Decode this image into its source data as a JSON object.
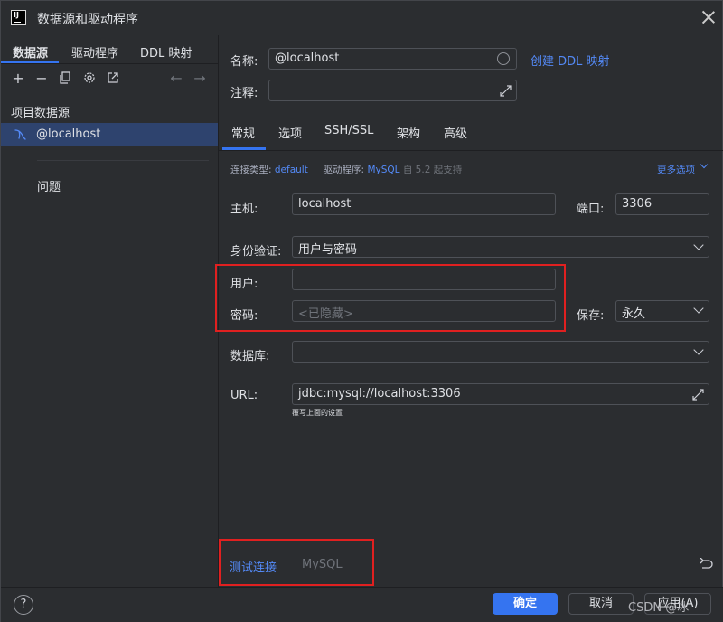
{
  "window": {
    "title": "数据源和驱动程序",
    "logo_text": "IJ"
  },
  "left_tabs": [
    "数据源",
    "驱动程序",
    "DDL 映射"
  ],
  "section_title": "项目数据源",
  "datasource": {
    "name": "@localhost"
  },
  "problems_label": "问题",
  "form": {
    "name_label": "名称:",
    "name_value": "@localhost",
    "create_ddl_link": "创建 DDL 映射",
    "comment_label": "注释:",
    "comment_value": ""
  },
  "tabs": [
    "常规",
    "选项",
    "SSH/SSL",
    "架构",
    "高级"
  ],
  "connection": {
    "type_label": "连接类型:",
    "type_value": "default",
    "driver_label": "驱动程序:",
    "driver_value": "MySQL",
    "driver_note": "自 5.2 起支持",
    "more_options": "更多选项"
  },
  "host": {
    "label": "主机:",
    "value": "localhost",
    "port_label": "端口:",
    "port_value": "3306"
  },
  "auth": {
    "label": "身份验证:",
    "value": "用户与密码"
  },
  "user": {
    "label": "用户:",
    "value": ""
  },
  "password": {
    "label": "密码:",
    "placeholder": "<已隐藏>",
    "save_label": "保存:",
    "save_value": "永久"
  },
  "database": {
    "label": "数据库:",
    "value": ""
  },
  "url": {
    "label": "URL:",
    "value": "jdbc:mysql://localhost:3306",
    "hint": "覆写上面的设置"
  },
  "test": {
    "link": "测试连接",
    "driver": "MySQL"
  },
  "buttons": {
    "ok": "确定",
    "cancel": "取消",
    "apply": "应用(A)"
  },
  "help_icon_text": "?",
  "watermark": "CSDN @冰"
}
